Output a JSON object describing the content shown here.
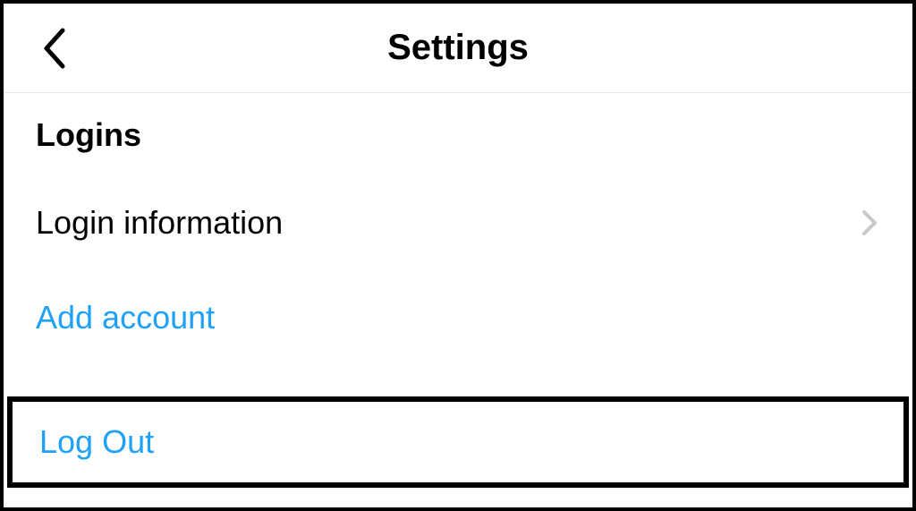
{
  "header": {
    "title": "Settings"
  },
  "section": {
    "title": "Logins"
  },
  "rows": {
    "login_information": "Login information",
    "add_account": "Add account",
    "log_out": "Log Out"
  },
  "colors": {
    "link": "#1ea1f7",
    "text": "#000000",
    "chevron": "#c7c7cc"
  }
}
